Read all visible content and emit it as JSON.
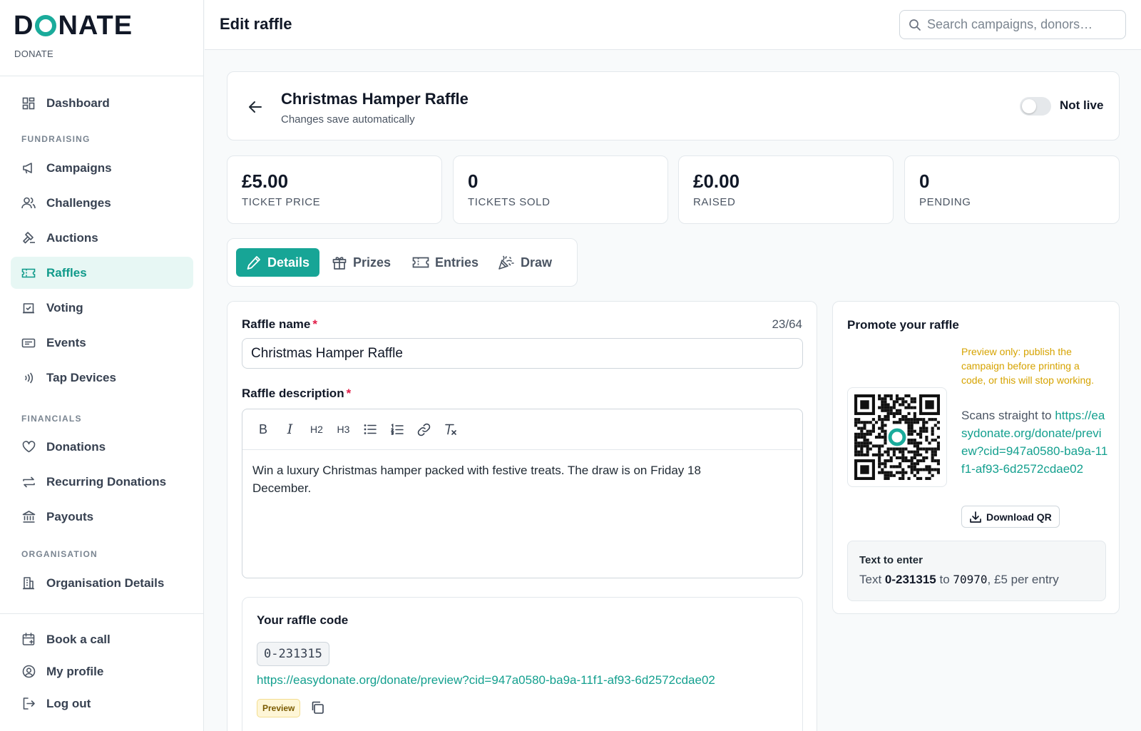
{
  "brand": {
    "logo_text_1": "D",
    "logo_text_2": "NATE",
    "subtitle": "DONATE"
  },
  "topbar": {
    "title": "Edit raffle",
    "search_placeholder": "Search campaigns, donors…"
  },
  "sidebar": {
    "dashboard": "Dashboard",
    "sections": {
      "fundraising": "FUNDRAISING",
      "financials": "FINANCIALS",
      "organisation": "ORGANISATION"
    },
    "items": {
      "campaigns": "Campaigns",
      "challenges": "Challenges",
      "auctions": "Auctions",
      "raffles": "Raffles",
      "voting": "Voting",
      "events": "Events",
      "tap_devices": "Tap Devices",
      "donations": "Donations",
      "recurring": "Recurring Donations",
      "payouts": "Payouts",
      "org_details": "Organisation Details",
      "book_call": "Book a call",
      "my_profile": "My profile",
      "log_out": "Log out"
    },
    "active_item": "Raffles"
  },
  "raffle_header": {
    "title": "Christmas Hamper Raffle",
    "subtitle": "Changes save automatically",
    "live_toggle": {
      "label": "Not live",
      "on": false
    }
  },
  "stats": [
    {
      "value": "£5.00",
      "label": "TICKET PRICE"
    },
    {
      "value": "0",
      "label": "TICKETS SOLD"
    },
    {
      "value": "£0.00",
      "label": "RAISED"
    },
    {
      "value": "0",
      "label": "PENDING"
    }
  ],
  "tabs": {
    "details": "Details",
    "prizes": "Prizes",
    "entries": "Entries",
    "draw": "Draw",
    "active": "Details"
  },
  "form": {
    "name_label": "Raffle name",
    "name_required": "*",
    "name_counter": "23/64",
    "name_value": "Christmas Hamper Raffle",
    "description_label": "Raffle description",
    "description_required": "*",
    "toolbar": {
      "bold": "B",
      "italic": "I",
      "h2": "H2",
      "h3": "H3"
    },
    "description_text": "Win a luxury Christmas hamper packed with festive treats. The draw is on Friday 18 December."
  },
  "raffle_code": {
    "title": "Your raffle code",
    "code": "0-231315",
    "link": "https://easydonate.org/donate/preview?cid=947a0580-ba9a-11f1-af93-6d2572cdae02",
    "badge": "Preview"
  },
  "promote": {
    "title": "Promote your raffle",
    "warning": "Preview only: publish the campaign before printing a code, or this will stop working.",
    "scan_prefix": "Scans straight to ",
    "scan_link": "https://easydonate.org/donate/preview?cid=947a0580-ba9a-11f1-af93-6d2572cdae02",
    "download_label": "Download QR",
    "text_to_enter": {
      "title": "Text to enter",
      "prefix": "Text ",
      "code": "0-231315",
      "middle": " to ",
      "number": "70970",
      "suffix": ", £5 per entry"
    }
  },
  "colors": {
    "accent": "#17a596",
    "link": "#14a08f",
    "warning": "#d6a300",
    "required": "#e11d48"
  }
}
